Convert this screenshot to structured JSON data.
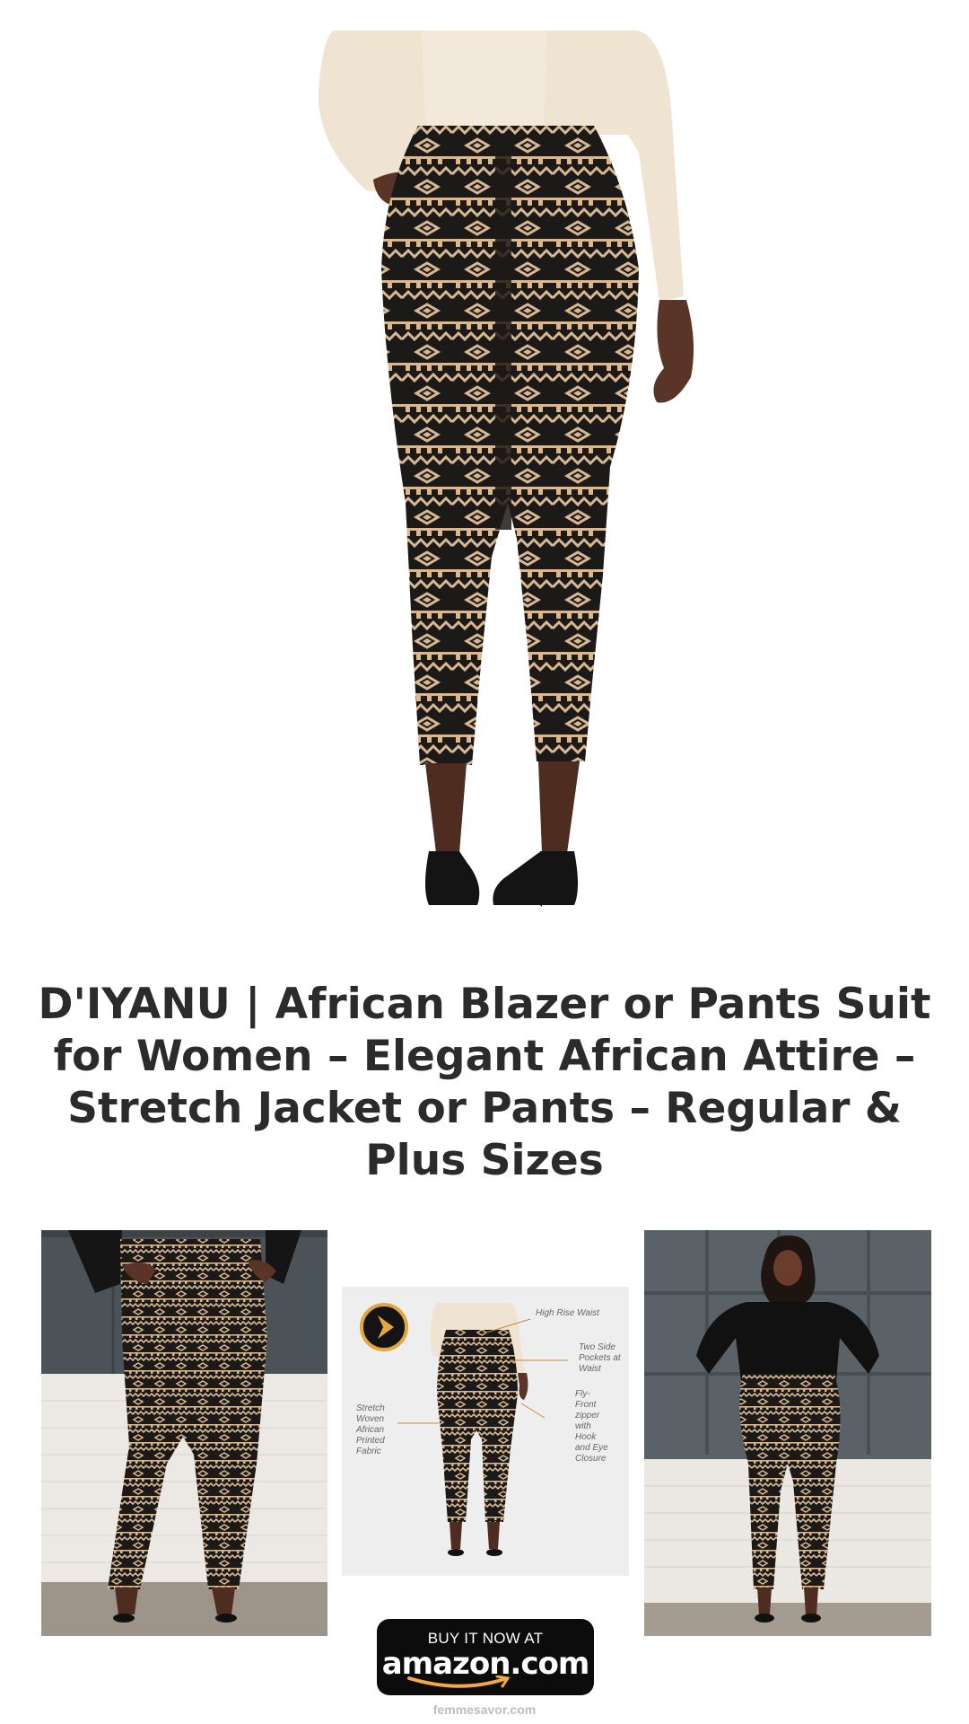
{
  "product": {
    "title": "D'IYANU | African Blazer or Pants Suit for Women – Elegant African Attire – Stretch Jacket or Pants – Regular & Plus Sizes"
  },
  "gallery": {
    "feature_callouts": {
      "high_rise": "High Rise Waist",
      "pockets": "Two Side\nPockets at\nWaist",
      "zipper": "Fly-\nFront\nzipper\nwith\nHook\nand Eye\nClosure",
      "fabric": "Stretch\nWoven\nAfrican\nPrinted\nFabric"
    }
  },
  "cta": {
    "top_label": "BUY IT NOW AT",
    "brand_label": "amazon.com"
  },
  "footer": {
    "site": "femmesavor.com"
  },
  "colors": {
    "title_text": "#2b2b2b",
    "pattern_dark": "#1c1a18",
    "pattern_tan": "#d8b892",
    "cream_top": "#efe4d2",
    "skin": "#5a3426",
    "amazon_smile": "#f3a847",
    "button_bg": "#0c0c0c"
  },
  "icons": {
    "play": "play-icon",
    "smile": "amazon-smile-icon"
  }
}
